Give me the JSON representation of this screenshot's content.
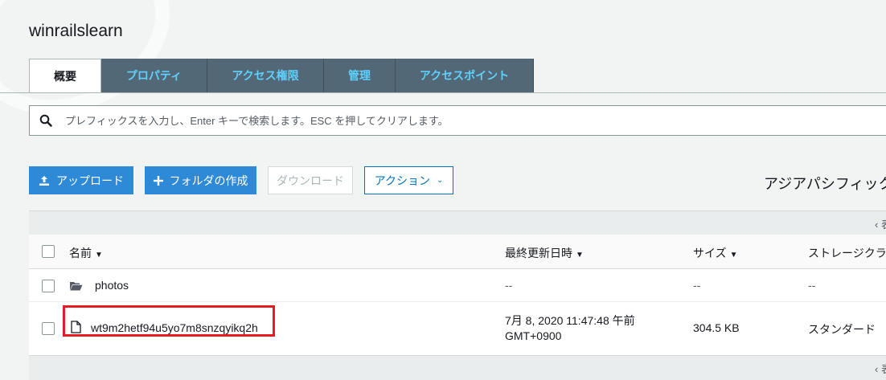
{
  "bucket_name": "winrailslearn",
  "tabs": [
    {
      "label": "概要",
      "active": true
    },
    {
      "label": "プロパティ",
      "active": false
    },
    {
      "label": "アクセス権限",
      "active": false
    },
    {
      "label": "管理",
      "active": false
    },
    {
      "label": "アクセスポイント",
      "active": false
    }
  ],
  "search": {
    "placeholder": "プレフィックスを入力し、Enter キーで検索します。ESC を押してクリアします。",
    "icon": "search-icon"
  },
  "toolbar": {
    "upload_label": "アップロード",
    "create_folder_label": "フォルダの作成",
    "download_label": "ダウンロード",
    "actions_label": "アクション"
  },
  "region": "アジアパシフィック",
  "view_toggle": "表",
  "table": {
    "headers": {
      "name": "名前",
      "modified": "最終更新日時",
      "size": "サイズ",
      "storage": "ストレージクラ"
    },
    "rows": [
      {
        "type": "folder",
        "name": "photos",
        "modified": "--",
        "size": "--",
        "storage": "--"
      },
      {
        "type": "file",
        "name": "wt9m2hetf94u5yo7m8snzqyikq2h",
        "modified_line1": "7月 8, 2020 11:47:48 午前",
        "modified_line2": "GMT+0900",
        "size": "304.5 KB",
        "storage": "スタンダード"
      }
    ]
  },
  "colors": {
    "tab_bg": "#536876",
    "tab_text": "#5fd1ff",
    "primary": "#2e8ad6",
    "highlight": "#e51c23"
  }
}
